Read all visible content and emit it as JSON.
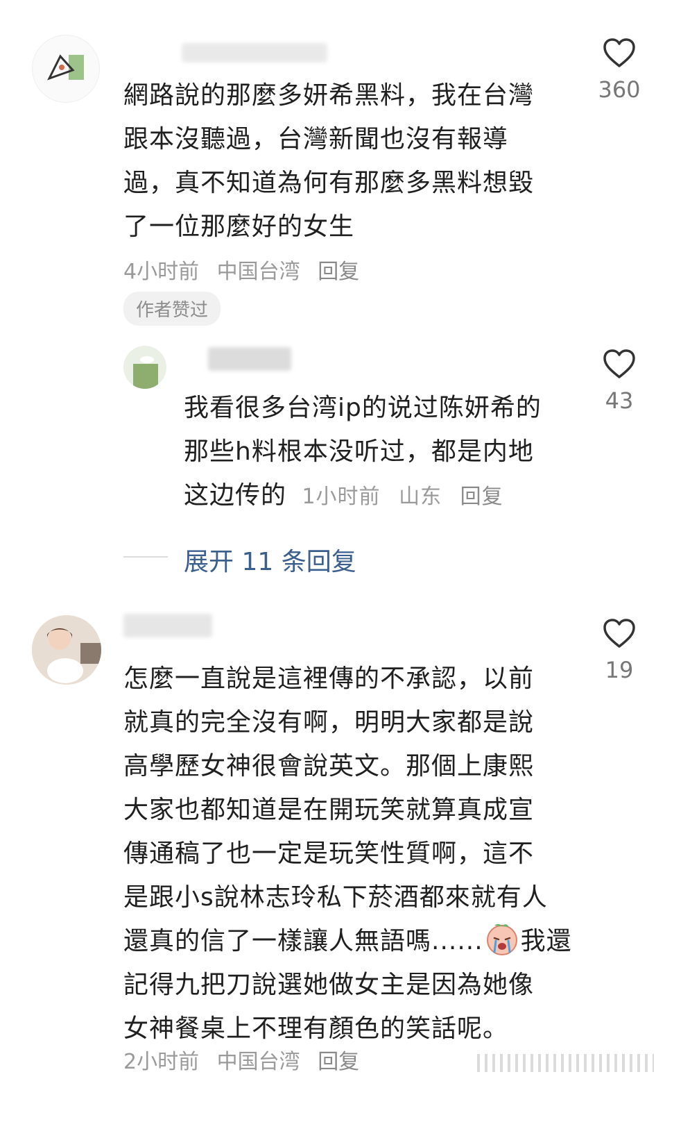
{
  "comments": [
    {
      "text_lines": [
        "網路說的那麼多妍希黑料，我在台灣",
        "跟本沒聽過，台灣新聞也沒有報導",
        "過，真不知道為何有那麼多黑料想毀",
        "了一位那麼好的女生"
      ],
      "time": "4小时前",
      "location": "中国台湾",
      "reply_label": "回复",
      "badge": "作者赞过",
      "likes": "360"
    },
    {
      "text_lines": [
        "我看很多台湾ip的说过陈妍希的",
        "那些h料根本没听过，都是内地",
        "这边传的"
      ],
      "time": "1小时前",
      "location": "山东",
      "reply_label": "回复",
      "likes": "43"
    },
    {
      "text_lines": [
        "怎麼一直說是這裡傳的不承認，以前",
        "就真的完全沒有啊，明明大家都是說",
        "高學歷女神很會說英文。那個上康熙",
        "大家也都知道是在開玩笑就算真成宣",
        "傳通稿了也一定是玩笑性質啊，這不",
        "是跟小s說林志玲私下菸酒都來就有人",
        "還真的信了一樣讓人無語嗎......",
        "我還",
        "記得九把刀說選她做女主是因為她像",
        "女神餐桌上不理有顏色的笑話呢。"
      ],
      "time": "2小时前",
      "location": "中国台湾",
      "reply_label": "回复",
      "likes": "19"
    }
  ],
  "expand_replies": "展开 11 条回复",
  "colors": {
    "like_icon": "#333333",
    "expand_link": "#3a5f8f",
    "meta": "#9a9a9a"
  },
  "icons": {
    "like": "heart-outline-icon",
    "emoji": "crying-face-emoji"
  }
}
